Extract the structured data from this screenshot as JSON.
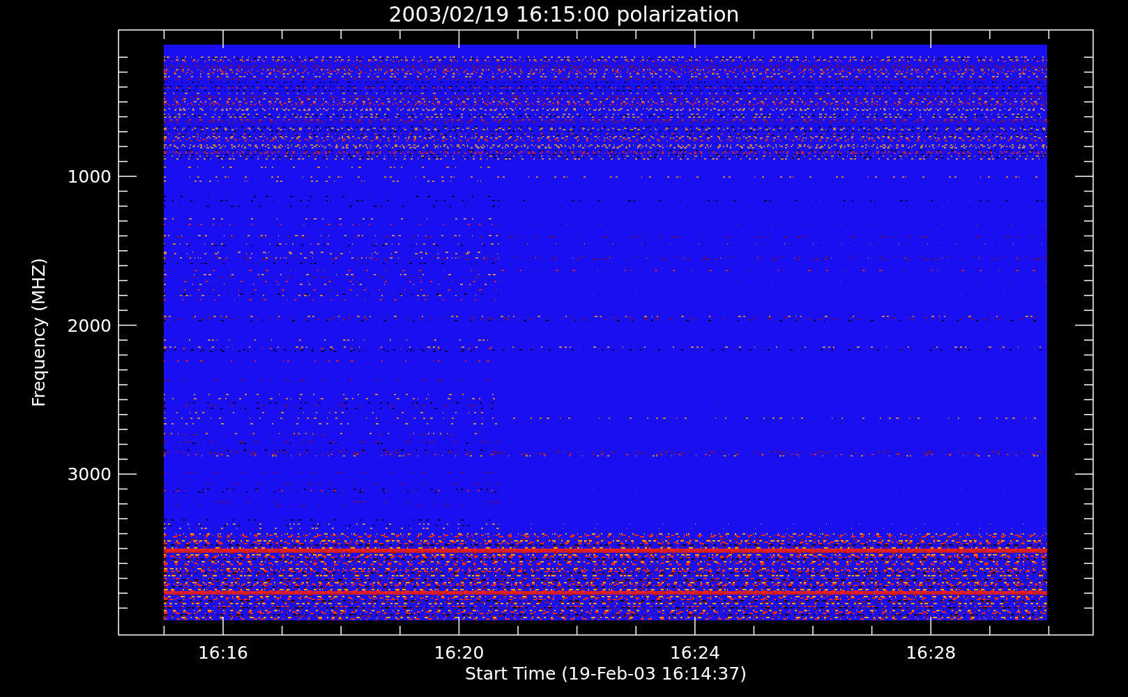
{
  "title": "2003/02/19 16:15:00 polarization",
  "plot": {
    "ylabel": "Frequency (MHZ)",
    "xlabel": "Start Time (19-Feb-03 16:14:37)",
    "xtick_labels": [
      "16:16",
      "16:20",
      "16:24",
      "16:28"
    ],
    "ytick_labels": [
      "1000",
      "2000",
      "3000"
    ]
  }
}
